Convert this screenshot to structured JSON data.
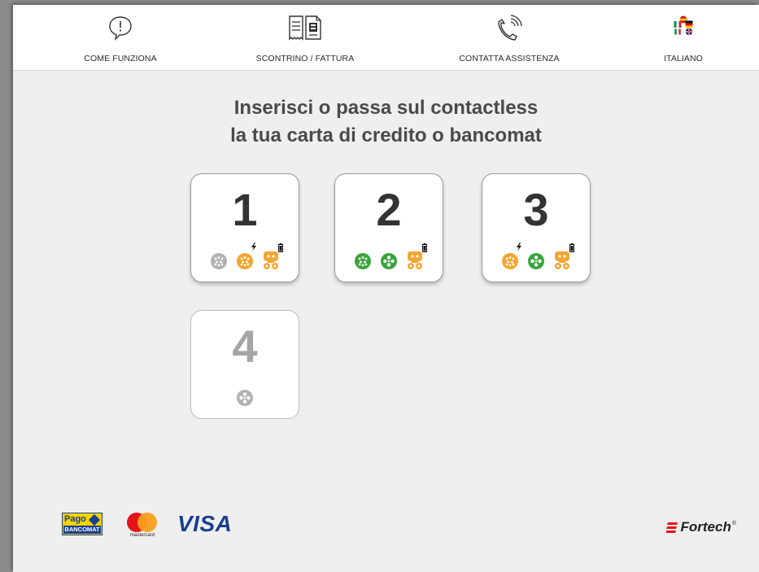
{
  "header": {
    "items": [
      {
        "label": "COME FUNZIONA",
        "icon": "info-speech-bubble-icon"
      },
      {
        "label": "SCONTRINO / FATTURA",
        "icon": "receipt-document-icon"
      },
      {
        "label": "CONTATTA ASSISTENZA",
        "icon": "phone-icon"
      },
      {
        "label": "ITALIANO",
        "icon": "language-flags-icon"
      }
    ]
  },
  "main": {
    "title_line1": "Inserisci o passa sul contactless",
    "title_line2": "la tua carta di credito o bancomat"
  },
  "charge_points": [
    {
      "number": "1",
      "enabled": true,
      "connectors": [
        {
          "type": "type2-socket",
          "color": "#b2b2b2",
          "bolt": false,
          "battery": false
        },
        {
          "type": "type2-socket",
          "color": "#f4a630",
          "bolt": true,
          "battery": false
        },
        {
          "type": "chademo-plug",
          "color": "#f4a630",
          "bolt": false,
          "battery": true
        }
      ]
    },
    {
      "number": "2",
      "enabled": true,
      "connectors": [
        {
          "type": "type2-socket",
          "color": "#3aa43b",
          "bolt": false,
          "battery": false
        },
        {
          "type": "type2-plug",
          "color": "#3aa43b",
          "bolt": false,
          "battery": false
        },
        {
          "type": "chademo-plug",
          "color": "#f4a630",
          "bolt": false,
          "battery": true
        }
      ]
    },
    {
      "number": "3",
      "enabled": true,
      "connectors": [
        {
          "type": "type2-socket",
          "color": "#f4a630",
          "bolt": true,
          "battery": false
        },
        {
          "type": "type2-plug",
          "color": "#3aa43b",
          "bolt": false,
          "battery": false
        },
        {
          "type": "chademo-plug",
          "color": "#f4a630",
          "bolt": false,
          "battery": true
        }
      ]
    },
    {
      "number": "4",
      "enabled": false,
      "connectors": [
        {
          "type": "type2-plug",
          "color": "#b2b2b2",
          "bolt": false,
          "battery": false
        }
      ]
    }
  ],
  "footer": {
    "pagobancomat_top": "Pago",
    "pagobancomat_bottom": "BANCOMAT",
    "mastercard_label": "mastercard",
    "visa_label": "VISA",
    "brand": "Fortech",
    "brand_mark": "®"
  },
  "colors": {
    "available": "#3aa43b",
    "charging": "#f4a630",
    "unavailable": "#b2b2b2",
    "text": "#4a4a4a"
  }
}
